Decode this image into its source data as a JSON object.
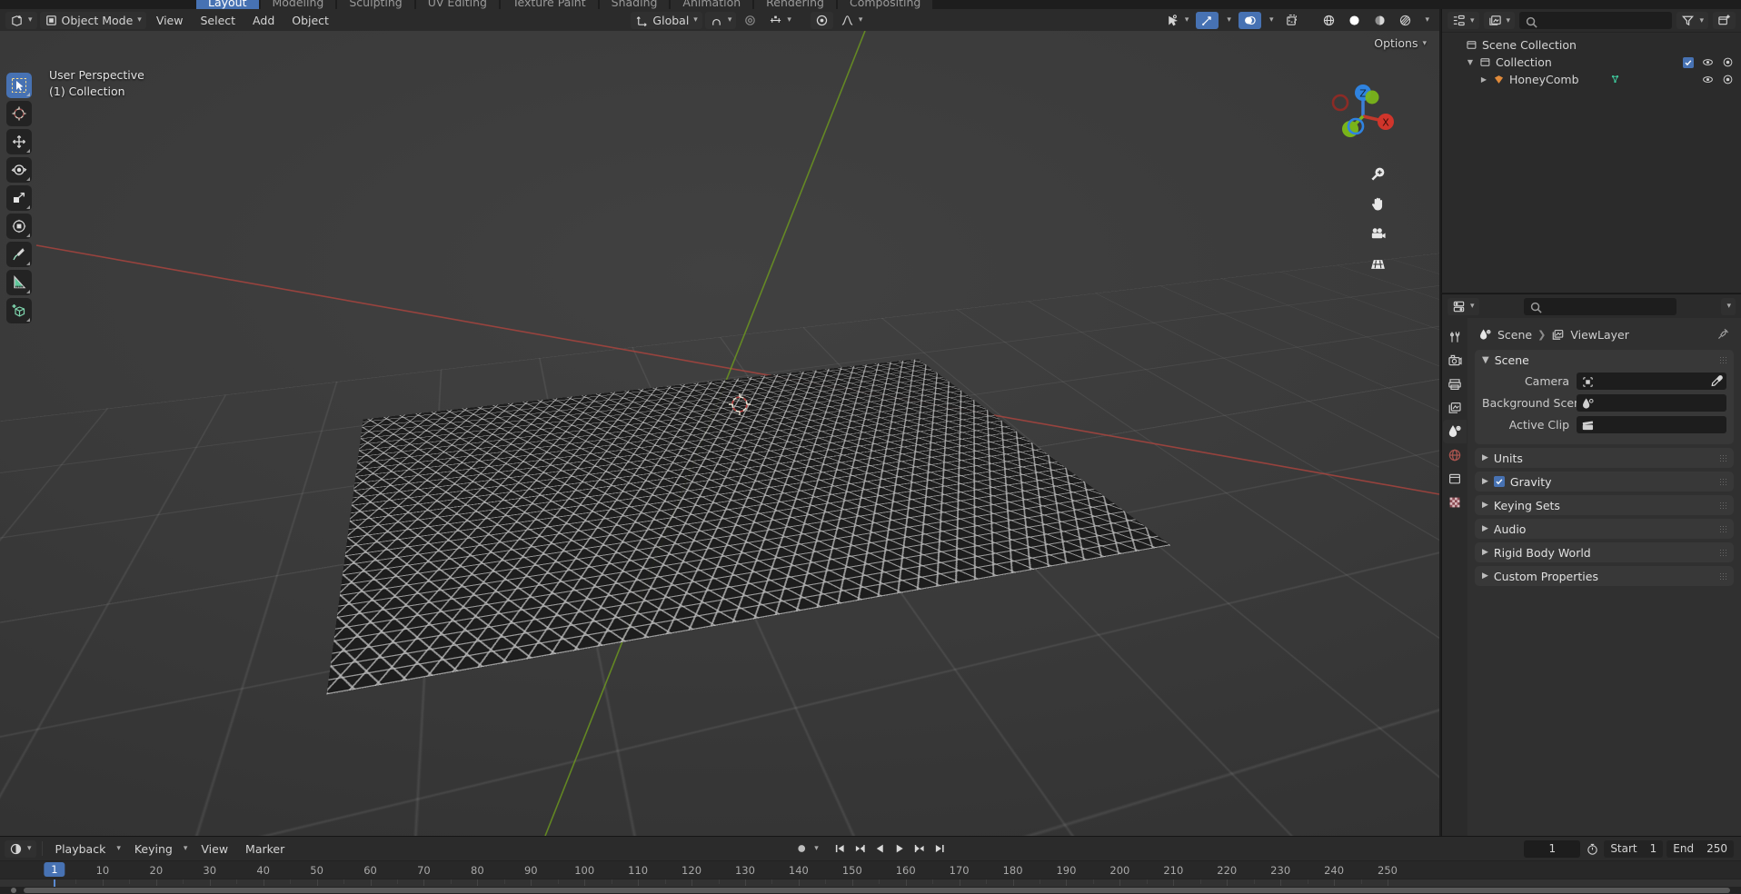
{
  "app": {
    "name": "Blender"
  },
  "topbar": {
    "tabs": [
      {
        "label": "Layout",
        "active": true
      },
      {
        "label": "Modeling",
        "active": false
      },
      {
        "label": "Sculpting",
        "active": false
      },
      {
        "label": "UV Editing",
        "active": false
      },
      {
        "label": "Texture Paint",
        "active": false
      },
      {
        "label": "Shading",
        "active": false
      },
      {
        "label": "Animation",
        "active": false
      },
      {
        "label": "Rendering",
        "active": false
      },
      {
        "label": "Compositing",
        "active": false
      }
    ]
  },
  "viewport": {
    "editor_type_icon": "editor-type-icon",
    "mode": "Object Mode",
    "menus": [
      "View",
      "Select",
      "Add",
      "Object"
    ],
    "select_modes": [
      "tweak-select-icon",
      "box-select-icon",
      "circle-select-icon",
      "lasso-select-icon",
      "select-mode-icon"
    ],
    "transform_orientation": "Global",
    "snap_icon": "magnet-icon",
    "proportional_icon": "proportional-editing-icon",
    "falloff_icon": "proportional-falloff-icon",
    "pivot_icon": "pivot-point-icon",
    "visibility_icon": "show-gizmo-icon",
    "gizmo_icon": "gizmo-icon",
    "overlays_icon": "overlays-icon",
    "xray_icon": "xray-icon",
    "shading_modes": [
      "wireframe-shading-icon",
      "solid-shading-icon",
      "material-preview-icon",
      "rendered-shading-icon"
    ],
    "active_shading": "solid-shading-icon",
    "options_label": "Options",
    "overlay_line1": "User Perspective",
    "overlay_line2": "(1) Collection",
    "gizmo_axes": [
      "Z",
      "X",
      "Y"
    ],
    "nav_buttons": [
      "zoom-icon",
      "pan-hand-icon",
      "camera-view-icon",
      "toggle-perspective-icon"
    ],
    "tools": [
      {
        "name": "tweak-tool",
        "active": true
      },
      {
        "name": "cursor-tool",
        "active": false
      },
      {
        "name": "move-tool",
        "active": false
      },
      {
        "name": "rotate-tool",
        "active": false
      },
      {
        "name": "scale-tool",
        "active": false
      },
      {
        "name": "transform-tool",
        "active": false
      },
      {
        "name": "annotate-tool",
        "active": false
      },
      {
        "name": "measure-tool",
        "active": false
      },
      {
        "name": "add-cube-tool",
        "active": false
      }
    ]
  },
  "outliner": {
    "display_mode_icon": "outliner-display-mode-icon",
    "filter_icon": "filter-icon",
    "new_collection_icon": "new-collection-icon",
    "search_placeholder": "",
    "rows": [
      {
        "label": "Scene Collection",
        "depth": 0,
        "icon": "scene-collection-icon",
        "has_triangle": false,
        "checkbox": false,
        "eye": false,
        "camera": false
      },
      {
        "label": "Collection",
        "depth": 1,
        "icon": "collection-icon",
        "has_triangle": true,
        "expanded": true,
        "checkbox": true,
        "eye": true,
        "camera": true
      },
      {
        "label": "HoneyComb",
        "depth": 2,
        "icon": "mesh-data-icon",
        "has_triangle": true,
        "expanded": false,
        "checkbox": false,
        "eye": true,
        "camera": true,
        "extra_icon": "mesh-vertex-icon"
      }
    ]
  },
  "properties": {
    "editor_type_icon": "properties-editor-icon",
    "search_placeholder": "",
    "tabs": [
      {
        "name": "tool-tab",
        "active": false
      },
      {
        "name": "render-tab",
        "active": false
      },
      {
        "name": "output-tab",
        "active": false
      },
      {
        "name": "view-layer-tab",
        "active": false
      },
      {
        "name": "scene-tab",
        "active": true
      },
      {
        "name": "world-tab",
        "active": false
      },
      {
        "name": "collection-tab",
        "active": false
      },
      {
        "name": "texture-tab",
        "active": false
      }
    ],
    "breadcrumb": [
      "Scene",
      "ViewLayer"
    ],
    "scene_panel": {
      "title": "Scene",
      "expanded": true,
      "fields": [
        {
          "label": "Camera",
          "value": "",
          "icon": "camera-data-icon",
          "eyedropper": true
        },
        {
          "label": "Background Scene",
          "value": "",
          "icon": "scene-data-icon",
          "eyedropper": false
        },
        {
          "label": "Active Clip",
          "value": "",
          "icon": "movie-clip-icon",
          "eyedropper": false
        }
      ]
    },
    "sections": [
      {
        "label": "Units",
        "expanded": false,
        "checkbox": null
      },
      {
        "label": "Gravity",
        "expanded": false,
        "checkbox": true
      },
      {
        "label": "Keying Sets",
        "expanded": false,
        "checkbox": null
      },
      {
        "label": "Audio",
        "expanded": false,
        "checkbox": null
      },
      {
        "label": "Rigid Body World",
        "expanded": false,
        "checkbox": null
      },
      {
        "label": "Custom Properties",
        "expanded": false,
        "checkbox": null
      }
    ]
  },
  "timeline": {
    "editor_type_icon": "timeline-editor-icon",
    "menus": [
      "Playback",
      "Keying",
      "View",
      "Marker"
    ],
    "record_icon": "auto-keying-icon",
    "transport": [
      "jump-to-start-icon",
      "jump-to-keyframe-prev-icon",
      "play-reverse-icon",
      "play-icon",
      "jump-to-keyframe-next-icon",
      "jump-to-end-icon"
    ],
    "current_frame": "1",
    "use_preview_range_icon": "preview-range-icon",
    "start_label": "Start",
    "start_value": "1",
    "end_label": "End",
    "end_value": "250",
    "playhead_frame": "1",
    "ruler_ticks": [
      "10",
      "20",
      "30",
      "40",
      "50",
      "60",
      "70",
      "80",
      "90",
      "100",
      "110",
      "120",
      "130",
      "140",
      "150",
      "160",
      "170",
      "180",
      "190",
      "200",
      "210",
      "220",
      "230",
      "240",
      "250"
    ]
  },
  "colors": {
    "accent_blue": "#4772b3",
    "panel_bg": "#303030",
    "header_bg": "#2b2b2b",
    "viewport_bg": "#3b3b3b",
    "axis_x_red": "#a33b3b",
    "axis_y_green": "#6a9a1f",
    "mesh_wire": "#c8c8c8",
    "mesh_data_green": "#3ec79b",
    "object_orange": "#e08a3a"
  }
}
